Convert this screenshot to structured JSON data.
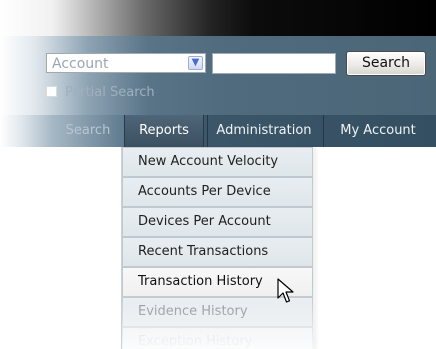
{
  "search_bar": {
    "account_select_value": "Account",
    "partial_search_label": "Partial Search",
    "search_button_label": "Search"
  },
  "nav": {
    "items": [
      {
        "label": "Search"
      },
      {
        "label": "Reports"
      },
      {
        "label": "Administration"
      },
      {
        "label": "My Account"
      }
    ]
  },
  "reports_menu": {
    "items": [
      {
        "label": "New Account Velocity"
      },
      {
        "label": "Accounts Per Device"
      },
      {
        "label": "Devices Per Account"
      },
      {
        "label": "Recent Transactions"
      },
      {
        "label": "Transaction History"
      },
      {
        "label": "Evidence History"
      },
      {
        "label": "Exception History"
      }
    ]
  },
  "icons": {
    "select_arrow": "chevron-down-icon",
    "pointer": "cursor-icon"
  },
  "colors": {
    "nav_background": "#344f61",
    "menu_background": "#e0e6ea",
    "hover_background": "#f8f8f8"
  }
}
